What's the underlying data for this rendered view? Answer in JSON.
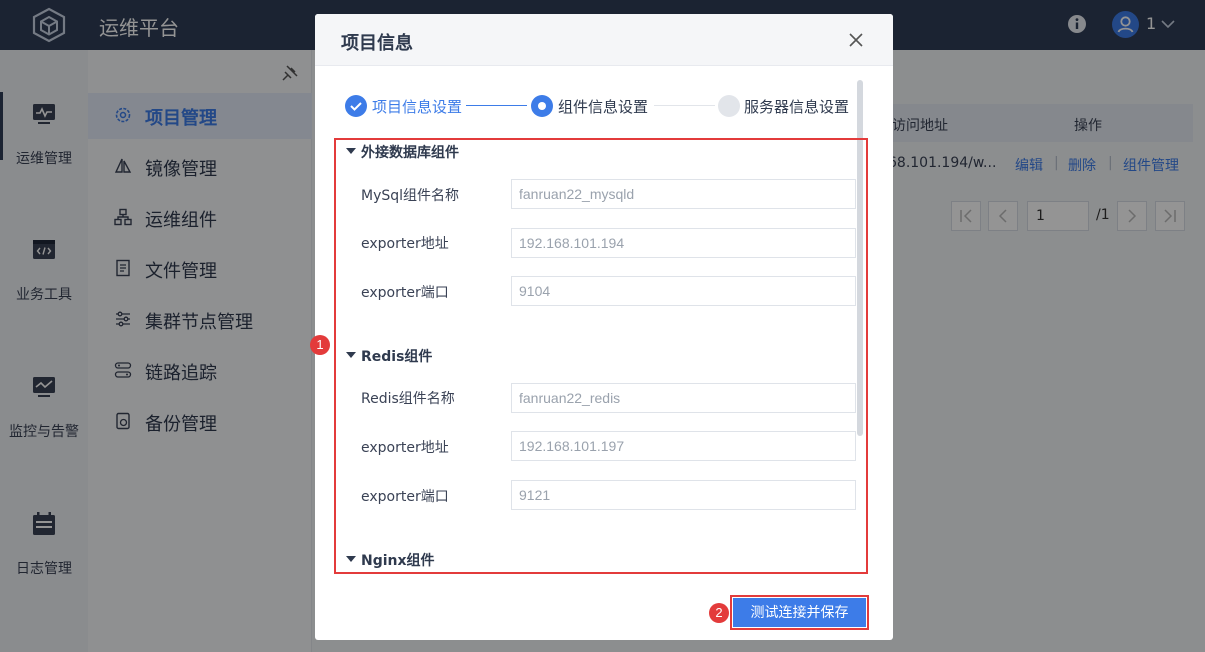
{
  "app": {
    "title": "运维平台",
    "user": "1",
    "accent": "#3d7ce8",
    "topbar_color": "#2f3d57"
  },
  "rail": {
    "items": [
      {
        "label": "运维管理",
        "icon": "monitor-icon"
      },
      {
        "label": "业务工具",
        "icon": "code-window-icon"
      },
      {
        "label": "监控与告警",
        "icon": "chart-monitor-icon"
      },
      {
        "label": "日志管理",
        "icon": "calendar-icon"
      }
    ]
  },
  "menu": {
    "items": [
      {
        "label": "项目管理",
        "icon": "gear-icon"
      },
      {
        "label": "镜像管理",
        "icon": "sail-icon"
      },
      {
        "label": "运维组件",
        "icon": "hierarchy-icon"
      },
      {
        "label": "文件管理",
        "icon": "document-icon"
      },
      {
        "label": "集群节点管理",
        "icon": "sliders-icon"
      },
      {
        "label": "链路追踪",
        "icon": "trace-icon"
      },
      {
        "label": "备份管理",
        "icon": "backup-icon"
      }
    ]
  },
  "table": {
    "headers": {
      "address": "访问地址",
      "actions": "操作"
    },
    "row": {
      "address": "68.101.194/w...",
      "edit": "编辑",
      "delete": "删除",
      "components": "组件管理",
      "sep": "|"
    }
  },
  "pager": {
    "page": "1",
    "total": "/1"
  },
  "modal": {
    "title": "项目信息",
    "steps": [
      {
        "label": "项目信息设置",
        "state": "done"
      },
      {
        "label": "组件信息设置",
        "state": "current"
      },
      {
        "label": "服务器信息设置",
        "state": "pending"
      }
    ],
    "sections": [
      {
        "title": "外接数据库组件",
        "fields": [
          {
            "label": "MySql组件名称",
            "value": "fanruan22_mysqld"
          },
          {
            "label": "exporter地址",
            "value": "192.168.101.194"
          },
          {
            "label": "exporter端口",
            "value": "9104"
          }
        ]
      },
      {
        "title": "Redis组件",
        "fields": [
          {
            "label": "Redis组件名称",
            "value": "fanruan22_redis"
          },
          {
            "label": "exporter地址",
            "value": "192.168.101.197"
          },
          {
            "label": "exporter端口",
            "value": "9121"
          }
        ]
      },
      {
        "title": "Nginx组件",
        "fields": []
      }
    ],
    "save_label": "测试连接并保存"
  },
  "annotations": {
    "badge1": "1",
    "badge2": "2",
    "color": "#e33b3b"
  }
}
